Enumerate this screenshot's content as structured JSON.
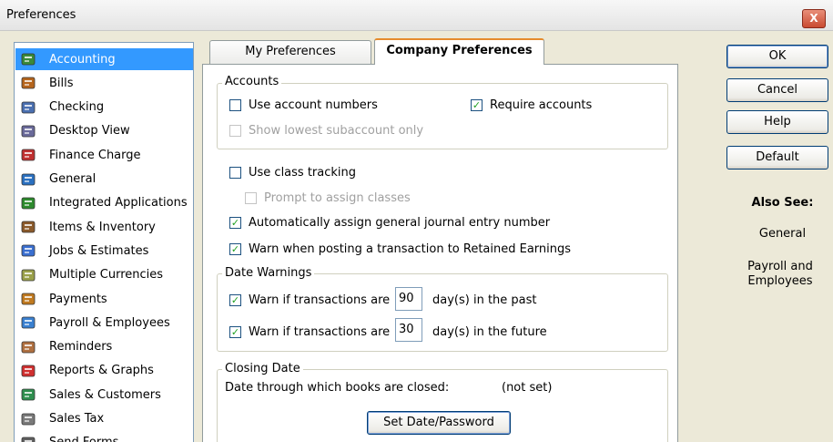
{
  "window": {
    "title": "Preferences",
    "close_glyph": "X"
  },
  "sidebar": {
    "items": [
      {
        "label": "Accounting",
        "icon": "accounting-icon",
        "color": "#3a8a3a",
        "selected": true
      },
      {
        "label": "Bills",
        "icon": "bills-icon",
        "color": "#b5651d"
      },
      {
        "label": "Checking",
        "icon": "checking-icon",
        "color": "#4a6fb0"
      },
      {
        "label": "Desktop View",
        "icon": "desktop-view-icon",
        "color": "#6a6a9a"
      },
      {
        "label": "Finance Charge",
        "icon": "finance-charge-icon",
        "color": "#c03030"
      },
      {
        "label": "General",
        "icon": "general-icon",
        "color": "#2a70c0"
      },
      {
        "label": "Integrated Applications",
        "icon": "integrated-apps-icon",
        "color": "#2e8b2e"
      },
      {
        "label": "Items & Inventory",
        "icon": "items-inventory-icon",
        "color": "#8b5a2b"
      },
      {
        "label": "Jobs & Estimates",
        "icon": "jobs-estimates-icon",
        "color": "#3a6fd0"
      },
      {
        "label": "Multiple Currencies",
        "icon": "multiple-currencies-icon",
        "color": "#9aa04a"
      },
      {
        "label": "Payments",
        "icon": "payments-icon",
        "color": "#c07a20"
      },
      {
        "label": "Payroll & Employees",
        "icon": "payroll-employees-icon",
        "color": "#3a80d0"
      },
      {
        "label": "Reminders",
        "icon": "reminders-icon",
        "color": "#b07040"
      },
      {
        "label": "Reports & Graphs",
        "icon": "reports-graphs-icon",
        "color": "#d03030"
      },
      {
        "label": "Sales & Customers",
        "icon": "sales-customers-icon",
        "color": "#2f8f4f"
      },
      {
        "label": "Sales Tax",
        "icon": "sales-tax-icon",
        "color": "#7a7a7a"
      },
      {
        "label": "Send Forms",
        "icon": "send-forms-icon",
        "color": "#606060"
      }
    ]
  },
  "tabs": [
    {
      "label": "My Preferences",
      "active": false
    },
    {
      "label": "Company Preferences",
      "active": true
    }
  ],
  "accounts_group": {
    "title": "Accounts",
    "use_account_numbers": {
      "label": "Use account numbers",
      "checked": false
    },
    "require_accounts": {
      "label": "Require accounts",
      "checked": true
    },
    "show_lowest_subaccount": {
      "label": "Show lowest subaccount only",
      "checked": false
    }
  },
  "class_tracking": {
    "label": "Use class tracking",
    "checked": false
  },
  "prompt_classes": {
    "label": "Prompt to assign classes",
    "checked": false
  },
  "auto_assign_journal": {
    "label": "Automatically assign general journal entry number",
    "checked": true
  },
  "warn_retained": {
    "label": "Warn when posting a transaction to Retained Earnings",
    "checked": true
  },
  "date_warnings": {
    "title": "Date Warnings",
    "past": {
      "label": "Warn if transactions are",
      "value": "90",
      "suffix": "day(s) in the past",
      "checked": true
    },
    "future": {
      "label": "Warn if transactions are",
      "value": "30",
      "suffix": "day(s) in the future",
      "checked": true
    }
  },
  "closing_date": {
    "title": "Closing Date",
    "description": "Date through which books are closed:",
    "value": "(not set)",
    "button_label": "Set Date/Password"
  },
  "buttons": {
    "ok": "OK",
    "cancel": "Cancel",
    "help": "Help",
    "default": "Default"
  },
  "also_see": {
    "title": "Also See:",
    "links": [
      "General",
      "Payroll and Employees"
    ]
  },
  "check_glyph": "✓"
}
